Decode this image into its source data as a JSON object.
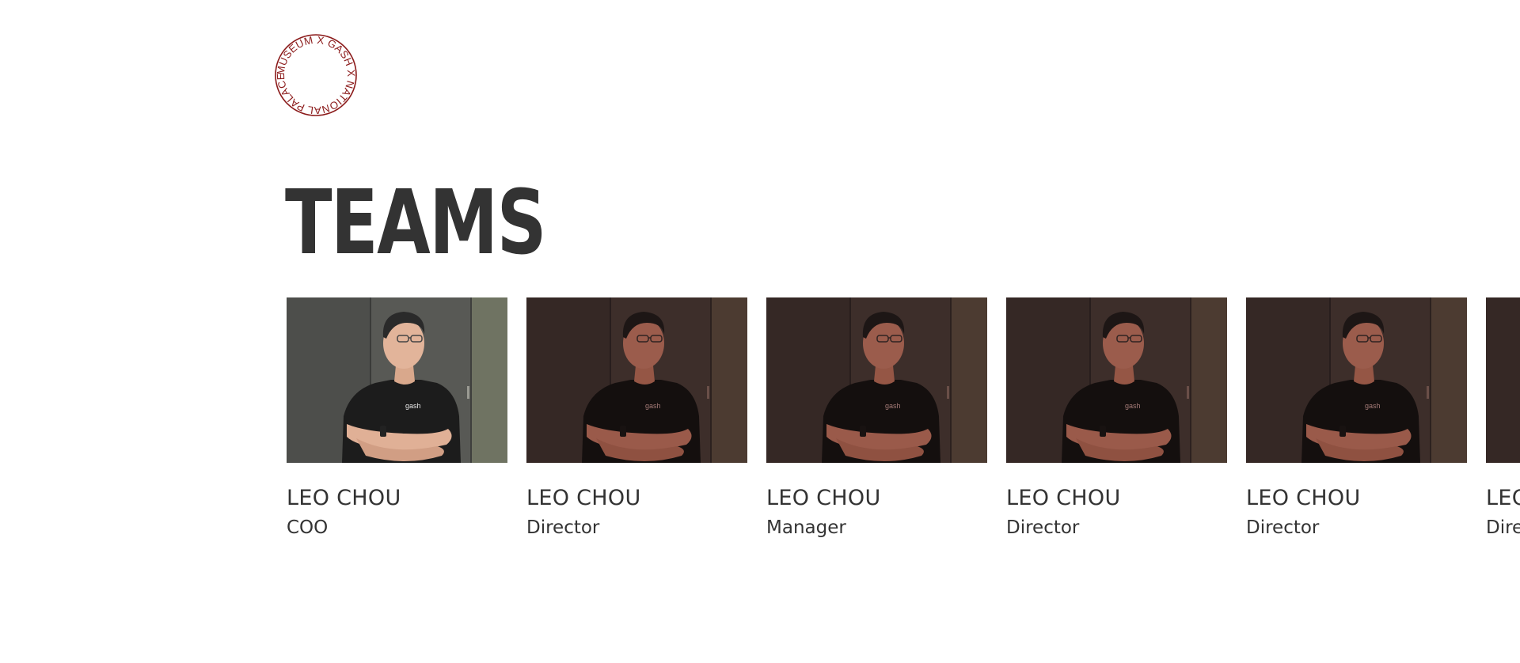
{
  "logo": {
    "ring_text": "MUSEUM X GASH X NATIONAL PALACE ",
    "color": "#8b1a1a"
  },
  "section": {
    "title": "TEAMS"
  },
  "team": [
    {
      "name": "LEO CHOU",
      "role": "COO",
      "active": true
    },
    {
      "name": "LEO CHOU",
      "role": "Director",
      "active": false
    },
    {
      "name": "LEO CHOU",
      "role": "Manager",
      "active": false
    },
    {
      "name": "LEO CHOU",
      "role": "Director",
      "active": false
    },
    {
      "name": "LEO CHOU",
      "role": "Director",
      "active": false
    },
    {
      "name": "LEO CHOU",
      "role": "Director",
      "active": false
    }
  ],
  "colors": {
    "text": "#333333",
    "tint": "#6e1c14",
    "background": "#ffffff"
  },
  "icons": {
    "logo": "circular-text-seal"
  }
}
